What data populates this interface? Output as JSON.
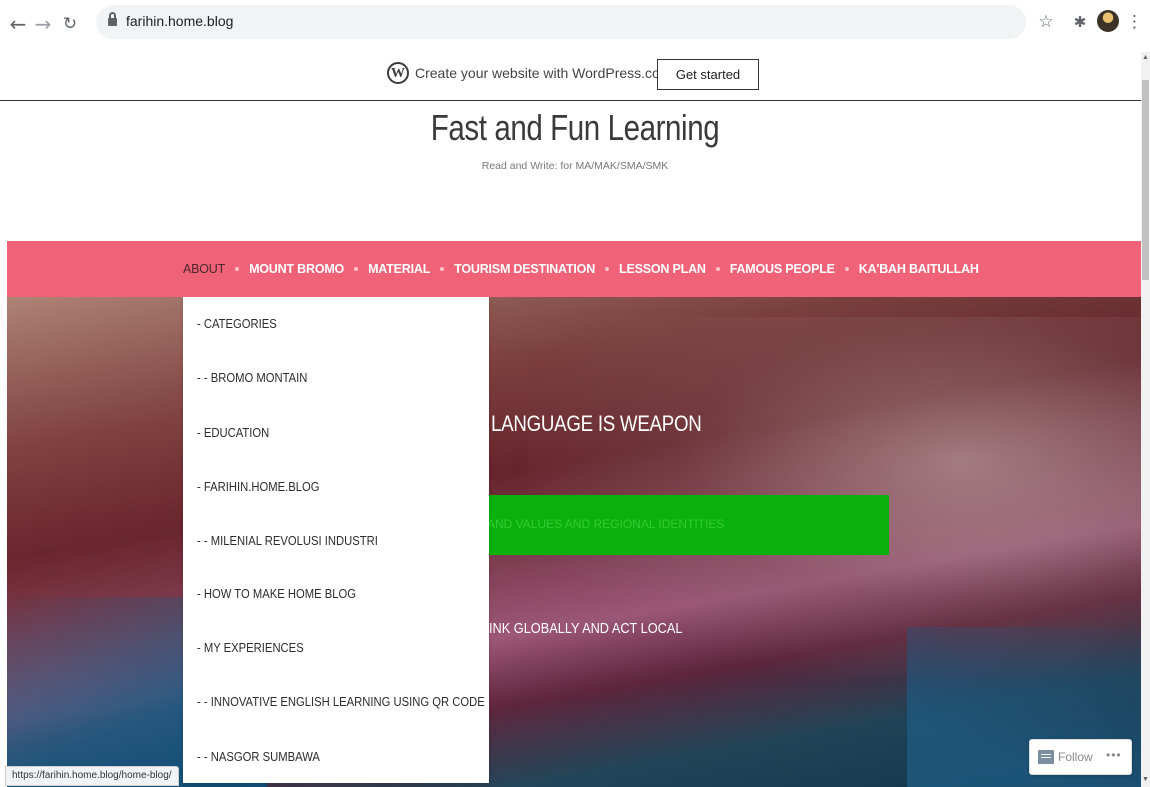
{
  "browser": {
    "url": "farihin.home.blog",
    "status_url": "https://farihin.home.blog/home-blog/"
  },
  "banner": {
    "text": "Create your website with WordPress.com",
    "button": "Get started"
  },
  "site": {
    "title": "Fast and Fun Learning",
    "tagline": "Read and Write: for MA/MAK/SMA/SMK"
  },
  "menu": [
    "ABOUT",
    "MOUNT BROMO",
    "MATERIAL",
    "TOURISM DESTINATION",
    "LESSON PLAN",
    "FAMOUS PEOPLE",
    "KA'BAH BAITULLAH"
  ],
  "dropdown": [
    "- CATEGORIES",
    "- - BROMO MONTAIN",
    "- EDUCATION",
    "- FARIHIN.HOME.BLOG",
    "- - MILENIAL REVOLUSI INDUSTRI",
    "- HOW TO MAKE HOME BLOG",
    "- MY EXPERIENCES",
    "- - INNOVATIVE ENGLISH LEARNING USING QR CODE",
    "- - NASGOR SUMBAWA"
  ],
  "hero": {
    "heading": "LANGUAGE IS WEAPON",
    "green_text": "AND VALUES AND REGIONAL IDENTITIES",
    "subtext": "INK GLOBALLY AND ACT LOCAL"
  },
  "follow": {
    "label": "Follow",
    "more": "•••"
  },
  "colors": {
    "menu_bar": "#f06277",
    "hero_button": "#0bb10b"
  },
  "icons": {
    "back": "back-arrow-icon",
    "forward": "forward-arrow-icon",
    "reload": "reload-icon",
    "lock": "lock-icon",
    "star": "star-icon",
    "extensions": "puzzle-icon",
    "menu": "kebab-menu-icon",
    "wordpress": "wordpress-logo-icon"
  }
}
